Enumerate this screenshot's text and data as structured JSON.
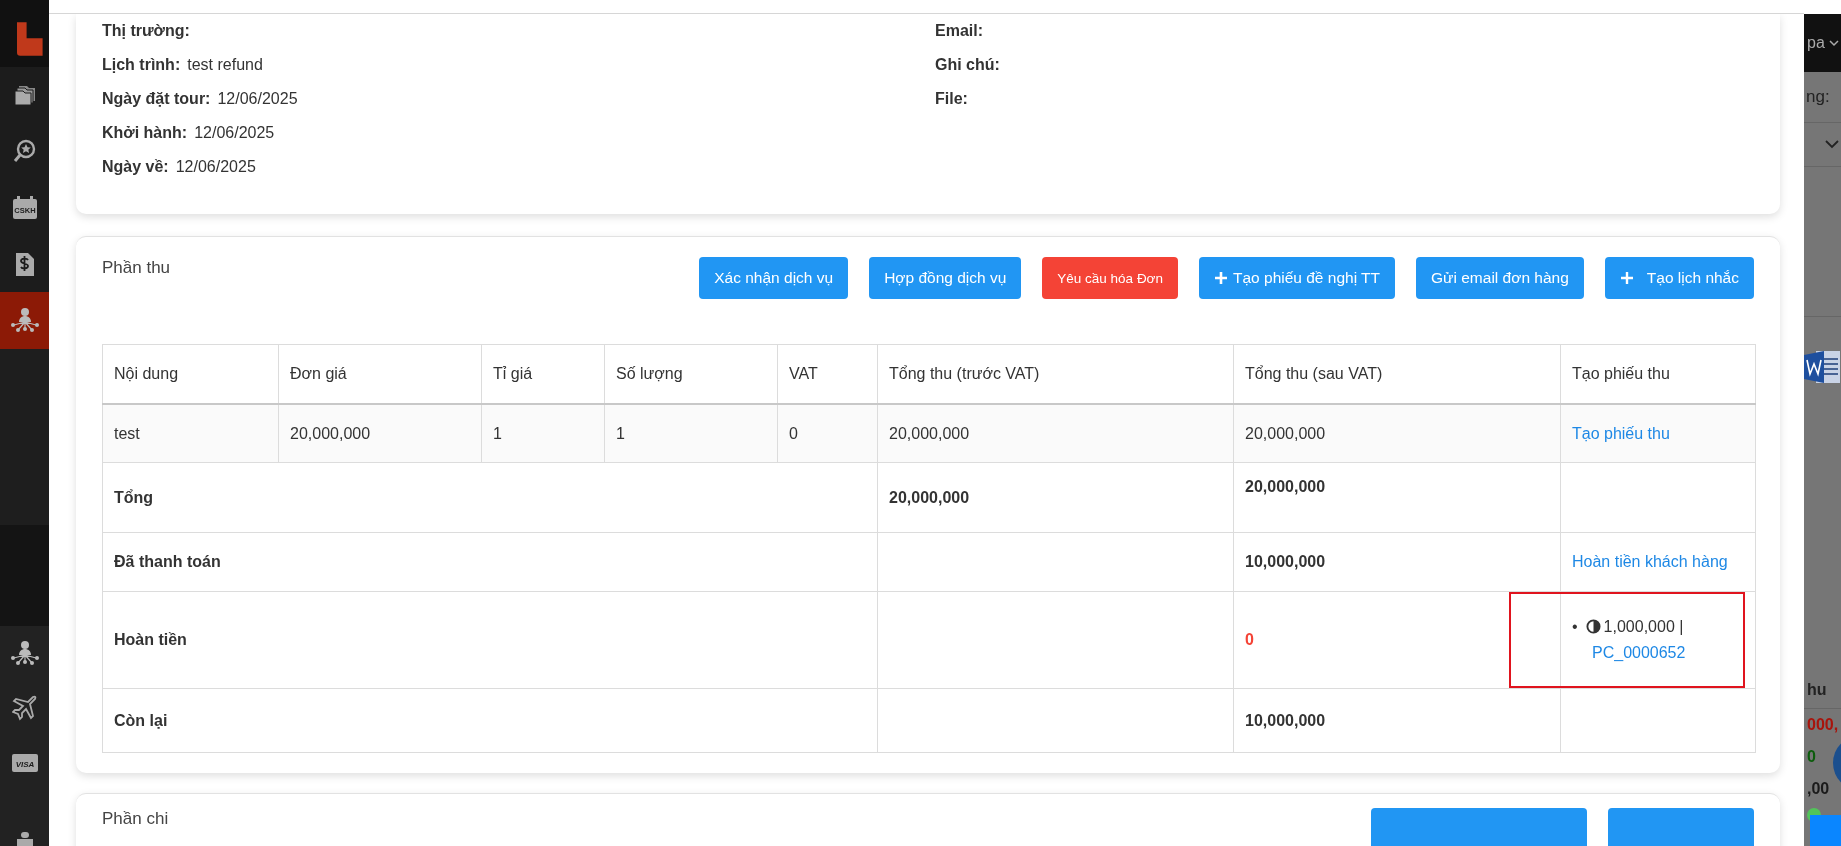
{
  "sidebar": {
    "items": [
      {
        "kind": "folders",
        "selected": false
      },
      {
        "kind": "search-star",
        "selected": false
      },
      {
        "kind": "calendar",
        "label": "CSKH",
        "selected": false
      },
      {
        "kind": "invoice",
        "selected": false
      },
      {
        "kind": "network",
        "selected": true
      }
    ],
    "bottom_items": [
      {
        "kind": "network",
        "selected": false
      },
      {
        "kind": "plane",
        "selected": false
      },
      {
        "kind": "card",
        "label": "VISA",
        "selected": false
      },
      {
        "kind": "partial",
        "selected": false
      }
    ]
  },
  "info": {
    "left": [
      {
        "label": "Thị trường:"
      },
      {
        "label": "Lịch trình:",
        "value": "test refund"
      },
      {
        "label": "Ngày đặt tour:",
        "value": "12/06/2025"
      },
      {
        "label": "Khởi hành:",
        "value": "12/06/2025"
      },
      {
        "label": "Ngày về:",
        "value": "12/06/2025"
      }
    ],
    "right": [
      {
        "label": "Email:"
      },
      {
        "label": "Ghi chú:"
      },
      {
        "label": "File:"
      }
    ]
  },
  "receipts": {
    "title": "Phần thu",
    "buttons": [
      {
        "label": "Xác nhận dịch vụ",
        "kind": "primary"
      },
      {
        "label": "Hợp đồng dịch vụ",
        "kind": "primary"
      },
      {
        "label": "Yêu cầu hóa Đơn",
        "kind": "danger"
      },
      {
        "label": "Tạo phiếu đề nghị TT",
        "kind": "plus"
      },
      {
        "label": "Gửi email đơn hàng",
        "kind": "primary"
      },
      {
        "label": "Tạo lịch nhắc",
        "kind": "plusgap"
      }
    ],
    "table": {
      "columns": [
        "Nội dung",
        "Đơn giá",
        "Tỉ giá",
        "Số lượng",
        "VAT",
        "Tổng thu (trước VAT)",
        "Tổng thu (sau VAT)",
        "Tạo phiếu thu"
      ],
      "rows": [
        {
          "kind": "item",
          "cells": [
            "test",
            "20,000,000",
            "1",
            "1",
            "0",
            "20,000,000",
            "20,000,000"
          ],
          "action": "Tạo phiếu thu"
        },
        {
          "kind": "summary",
          "label": "Tổng",
          "before_vat": "20,000,000",
          "after_vat": "20,000,000"
        },
        {
          "kind": "summary",
          "label": "Đã thanh toán",
          "after_vat": "10,000,000",
          "action": "Hoàn tiền khách hàng"
        },
        {
          "kind": "summary",
          "label": "Hoàn tiền",
          "after_vat": "0",
          "alert": true,
          "highlighted": true,
          "refunds": [
            {
              "bullet": "•",
              "amount": "1,000,000 |",
              "code": "PC_0000652"
            }
          ]
        },
        {
          "kind": "summary",
          "label": "Còn lại",
          "after_vat": "10,000,000"
        }
      ]
    }
  },
  "expenses": {
    "title": "Phần chi",
    "buttons": [
      {
        "kind": "primary"
      },
      {
        "kind": "primary"
      }
    ]
  },
  "background_page": {
    "menu_label": "pa",
    "field_label": "ng:",
    "column_heading": "hu",
    "values": [
      {
        "text": "000,",
        "color": "#a8140c"
      },
      {
        "text": "0",
        "color": "#0c5c0c"
      },
      {
        "text": ",00",
        "color": "#1a1a1a"
      }
    ]
  }
}
